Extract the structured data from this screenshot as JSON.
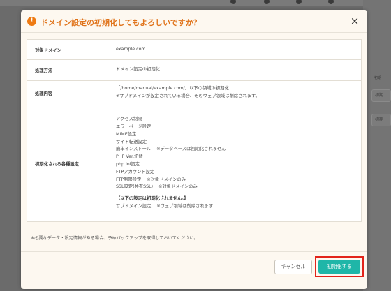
{
  "background": {
    "top_items": [
      "",
      "",
      ""
    ],
    "side_buttons": [
      "初期",
      "初期"
    ],
    "side_texts": [
      "初期"
    ]
  },
  "dialog": {
    "title": "ドメイン設定の初期化してもよろしいですか？",
    "close_label": "×",
    "rows": [
      {
        "label": "対象ドメイン",
        "lines": [
          "example.com"
        ]
      },
      {
        "label": "処理方法",
        "lines": [
          "ドメイン設定の初期化"
        ]
      },
      {
        "label": "処理内容",
        "lines": [
          "「/home/manual/example.com/」以下の領域の初期化",
          "※サブドメインが設定されている場合、そのウェブ領域は削除されます。"
        ]
      },
      {
        "label": "初期化される各種設定",
        "items": [
          {
            "text": "アクセス制限",
            "note": ""
          },
          {
            "text": "エラーページ設定",
            "note": ""
          },
          {
            "text": "MIME設定",
            "note": ""
          },
          {
            "text": "サイト転送設定",
            "note": ""
          },
          {
            "text": "簡単インストール",
            "note": "※データベースは初期化されません"
          },
          {
            "text": "PHP Ver.切替",
            "note": ""
          },
          {
            "text": "php.ini設定",
            "note": ""
          },
          {
            "text": "FTPアカウント設定",
            "note": ""
          },
          {
            "text": "FTP制限設定",
            "note": "※対象ドメインのみ"
          },
          {
            "text": "SSL設定(共有SSL)",
            "note": "※対象ドメインのみ"
          }
        ],
        "bold_line": "【以下の設定は初期化されません。】",
        "last_item": {
          "text": "サブドメイン設定",
          "note": "※ウェブ領域は削除されます"
        }
      }
    ],
    "footer_note": "※必要なデータ・設定情報がある場合、予めバックアップを取得しておいてください。",
    "cancel_label": "キャンセル",
    "confirm_label": "初期化する",
    "colors": {
      "title": "#e0731a",
      "confirm": "#1fb6a8",
      "highlight": "#e2231a",
      "warning_icon": "#ee7a12"
    }
  }
}
